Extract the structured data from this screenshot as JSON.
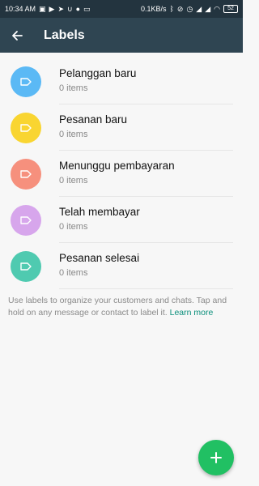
{
  "status_bar": {
    "time": "10:34 AM",
    "speed": "0.1KB/s",
    "battery": "52",
    "left_icons": [
      "notification-icon",
      "youtube-icon",
      "send-icon",
      "u-icon",
      "spotify-icon",
      "laptop-icon"
    ],
    "right_icons": [
      "bluetooth-icon",
      "mute-icon",
      "alarm-icon",
      "signal-icon",
      "signal-icon",
      "wifi-icon"
    ]
  },
  "app_bar": {
    "title": "Labels",
    "back_icon": "arrow-left-icon"
  },
  "labels": [
    {
      "name": "Pelanggan baru",
      "count": "0 items",
      "color": "#5bb9f5"
    },
    {
      "name": "Pesanan baru",
      "count": "0 items",
      "color": "#f9d531"
    },
    {
      "name": "Menunggu pembayaran",
      "count": "0 items",
      "color": "#f6907d"
    },
    {
      "name": "Telah membayar",
      "count": "0 items",
      "color": "#d7a6ec"
    },
    {
      "name": "Pesanan selesai",
      "count": "0 items",
      "color": "#4fcab0"
    }
  ],
  "hint": {
    "text": "Use labels to organize your customers and chats. Tap and hold on any message or contact to label it.",
    "link": "Learn more"
  },
  "fab": {
    "icon": "plus-icon",
    "color": "#21c063"
  },
  "colors": {
    "status_bar": "#23343f",
    "app_bar": "#2f4552",
    "accent": "#0a8f7b"
  }
}
